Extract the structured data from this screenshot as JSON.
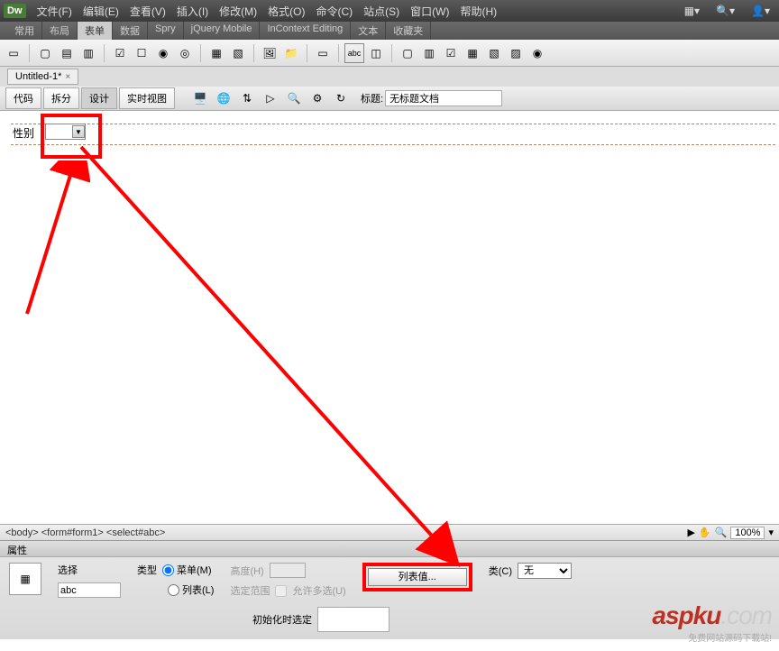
{
  "app": {
    "logo": "Dw",
    "menus": [
      "文件(F)",
      "编辑(E)",
      "查看(V)",
      "插入(I)",
      "修改(M)",
      "格式(O)",
      "命令(C)",
      "站点(S)",
      "窗口(W)",
      "帮助(H)"
    ]
  },
  "categories": [
    "常用",
    "布局",
    "表单",
    "数据",
    "Spry",
    "jQuery Mobile",
    "InContext Editing",
    "文本",
    "收藏夹"
  ],
  "active_category": "表单",
  "doc_tab": {
    "name": "Untitled-1*",
    "close": "×"
  },
  "view_modes": [
    "代码",
    "拆分",
    "设计",
    "实时视图"
  ],
  "active_view": "设计",
  "title_field": {
    "label": "标题:",
    "value": "无标题文档"
  },
  "design": {
    "field_label": "性别",
    "dropdown_icon": "▼"
  },
  "status": {
    "path": "<body> <form#form1> <select#abc>",
    "zoom": "100%",
    "arrow": "▾"
  },
  "properties": {
    "header": "属性",
    "select_label": "选择",
    "id_value": "abc",
    "type_label": "类型",
    "type_menu": "菜单(M)",
    "type_list": "列表(L)",
    "height_label": "高度(H)",
    "range_label": "选定范围",
    "multi_label": "允许多选(U)",
    "list_values_btn": "列表值...",
    "class_label": "类(C)",
    "class_value": "无",
    "init_label": "初始化时选定"
  },
  "watermark": {
    "main_bold": "aspku",
    "main_dim": ".com",
    "sub": "免费网站源码下载站!"
  }
}
